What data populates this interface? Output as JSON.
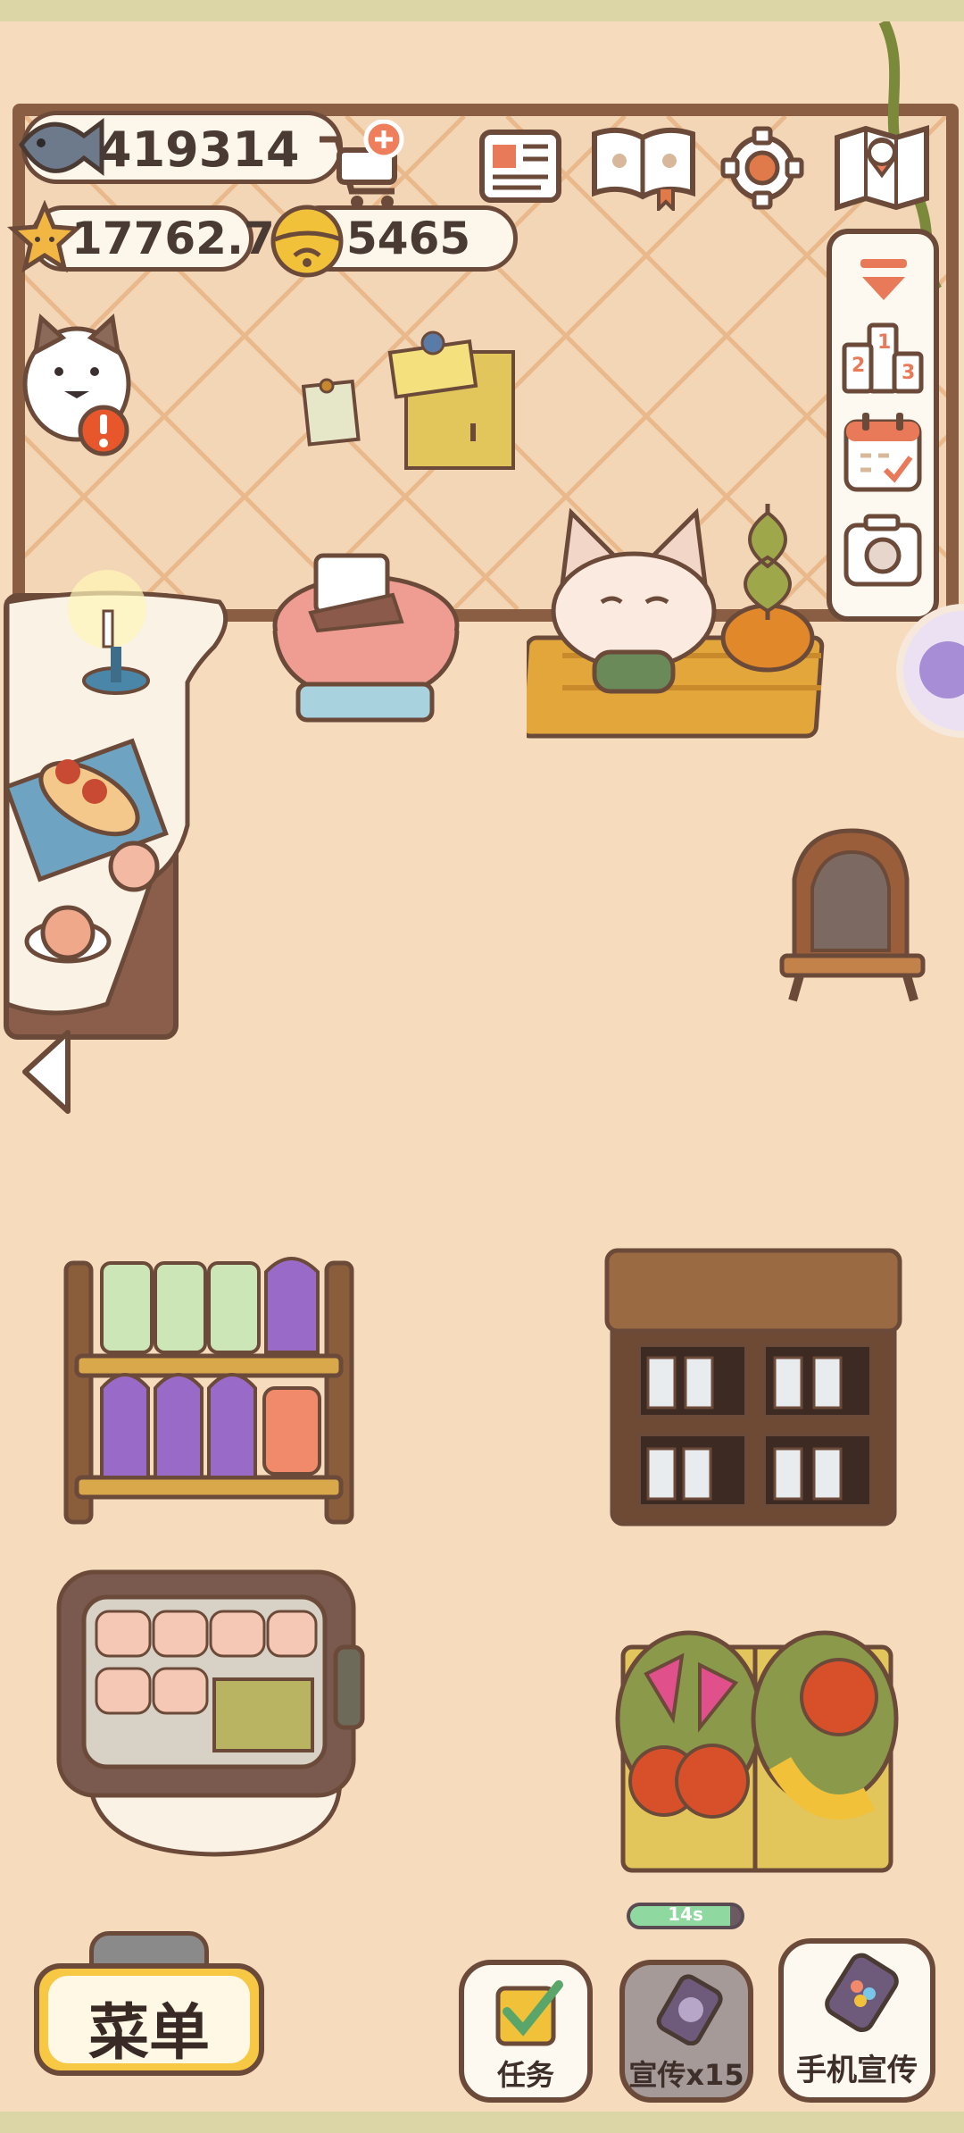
{
  "currency": {
    "fish": "419314",
    "stars": "17762.7",
    "bells": "5465"
  },
  "timer": {
    "text": "14s",
    "progress": 0.9
  },
  "buttons": {
    "menu": "菜单",
    "tasks": "任务",
    "promote": "宣传x15",
    "phone_promote": "手机宣传"
  },
  "icons": {
    "top_bar": [
      "fish-icon",
      "add-cart-icon",
      "newspaper-icon",
      "paw-book-icon",
      "gear-icon",
      "map-icon"
    ],
    "side_panel": [
      "collapse-arrow-icon",
      "ranking-podium-icon",
      "calendar-check-icon",
      "camera-icon"
    ]
  },
  "colors": {
    "outline": "#6b4a3a",
    "floor": "#f6dcbc",
    "wall_border": "#8a5e42",
    "menu_yellow": "#f7c843",
    "alert_red": "#e8562c",
    "timer_green": "#8fd8a0"
  }
}
